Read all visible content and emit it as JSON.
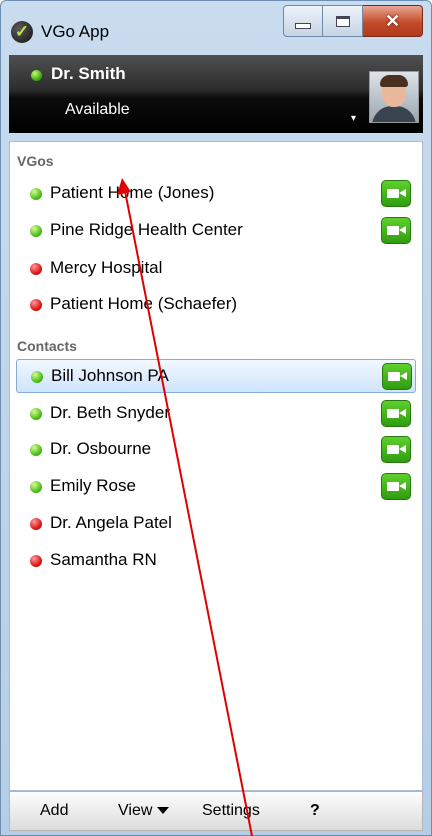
{
  "window": {
    "title": "VGo App"
  },
  "user": {
    "name": "Dr. Smith",
    "status": "Available",
    "status_dropdown": "▾"
  },
  "vgos": {
    "header": "VGos",
    "items": [
      {
        "label": "Patient Home (Jones)",
        "status": "online",
        "video": true
      },
      {
        "label": "Pine Ridge Health Center",
        "status": "online",
        "video": true
      },
      {
        "label": "Mercy Hospital",
        "status": "offline",
        "video": false
      },
      {
        "label": "Patient Home (Schaefer)",
        "status": "offline",
        "video": false
      }
    ]
  },
  "contacts": {
    "header": "Contacts",
    "items": [
      {
        "label": "Bill Johnson PA",
        "status": "online",
        "video": true,
        "selected": true
      },
      {
        "label": "Dr. Beth Snyder",
        "status": "online",
        "video": true
      },
      {
        "label": "Dr. Osbourne",
        "status": "online",
        "video": true
      },
      {
        "label": "Emily Rose",
        "status": "online",
        "video": true
      },
      {
        "label": "Dr. Angela Patel",
        "status": "offline",
        "video": false
      },
      {
        "label": "Samantha RN",
        "status": "offline",
        "video": false
      }
    ]
  },
  "menu": {
    "add": "Add",
    "view": "View",
    "settings": "Settings",
    "help": "?"
  },
  "colors": {
    "online": "#44b016",
    "offline": "#e01818",
    "video_button": "#3cb41a",
    "annotation_arrow": "#e00000"
  }
}
